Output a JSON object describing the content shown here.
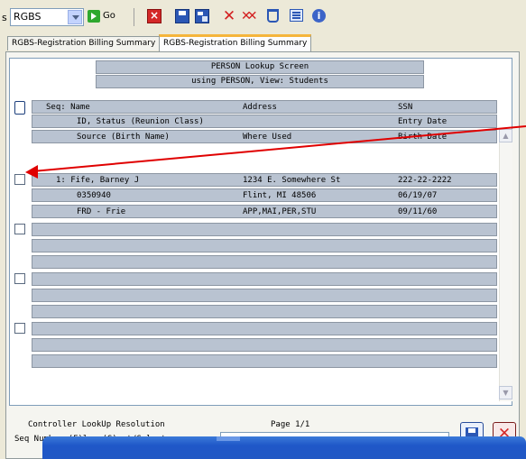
{
  "toolbar": {
    "prefix": "s",
    "module_select": "RGBS",
    "go_label": "Go",
    "icons": [
      "close-window-icon",
      "save-icon",
      "save-all-icon",
      "delete-icon",
      "delete-all-icon",
      "cup-icon",
      "list-icon",
      "help-icon"
    ]
  },
  "tabs": [
    {
      "label": "RGBS-Registration Billing Summary",
      "active": false
    },
    {
      "label": "RGBS-Registration Billing Summary",
      "active": true
    }
  ],
  "lookup": {
    "title_line1": "PERSON Lookup Screen",
    "title_line2": "using PERSON, View: Students",
    "headers": [
      {
        "c1": "Seq: Name",
        "c2": "Address",
        "c3": "SSN"
      },
      {
        "c1": "ID, Status (Reunion Class)",
        "c2": "",
        "c3": "Entry Date"
      },
      {
        "c1": "Source      (Birth Name)",
        "c2": "Where Used",
        "c3": "Birth Date"
      }
    ],
    "record": [
      {
        "c1": "1: Fife, Barney J",
        "c2": "1234 E. Somewhere St",
        "c3": "222-22-2222"
      },
      {
        "c1": "0350940",
        "c2": "Flint, MI 48506",
        "c3": "06/19/07"
      },
      {
        "c1": "FRD - Frie",
        "c2": "APP,MAI,PER,STU",
        "c3": "09/11/60"
      }
    ]
  },
  "footer": {
    "resolution_label": "Controller LookUp Resolution",
    "page_label": "Page 1/1",
    "prompt_label": "Seq Number,(F)lag,(S)ort/Select:",
    "prompt_value": ""
  },
  "colors": {
    "row_fill": "#b9c3d1",
    "arrow": "#e00000",
    "tab_accent": "#f5b53b"
  }
}
